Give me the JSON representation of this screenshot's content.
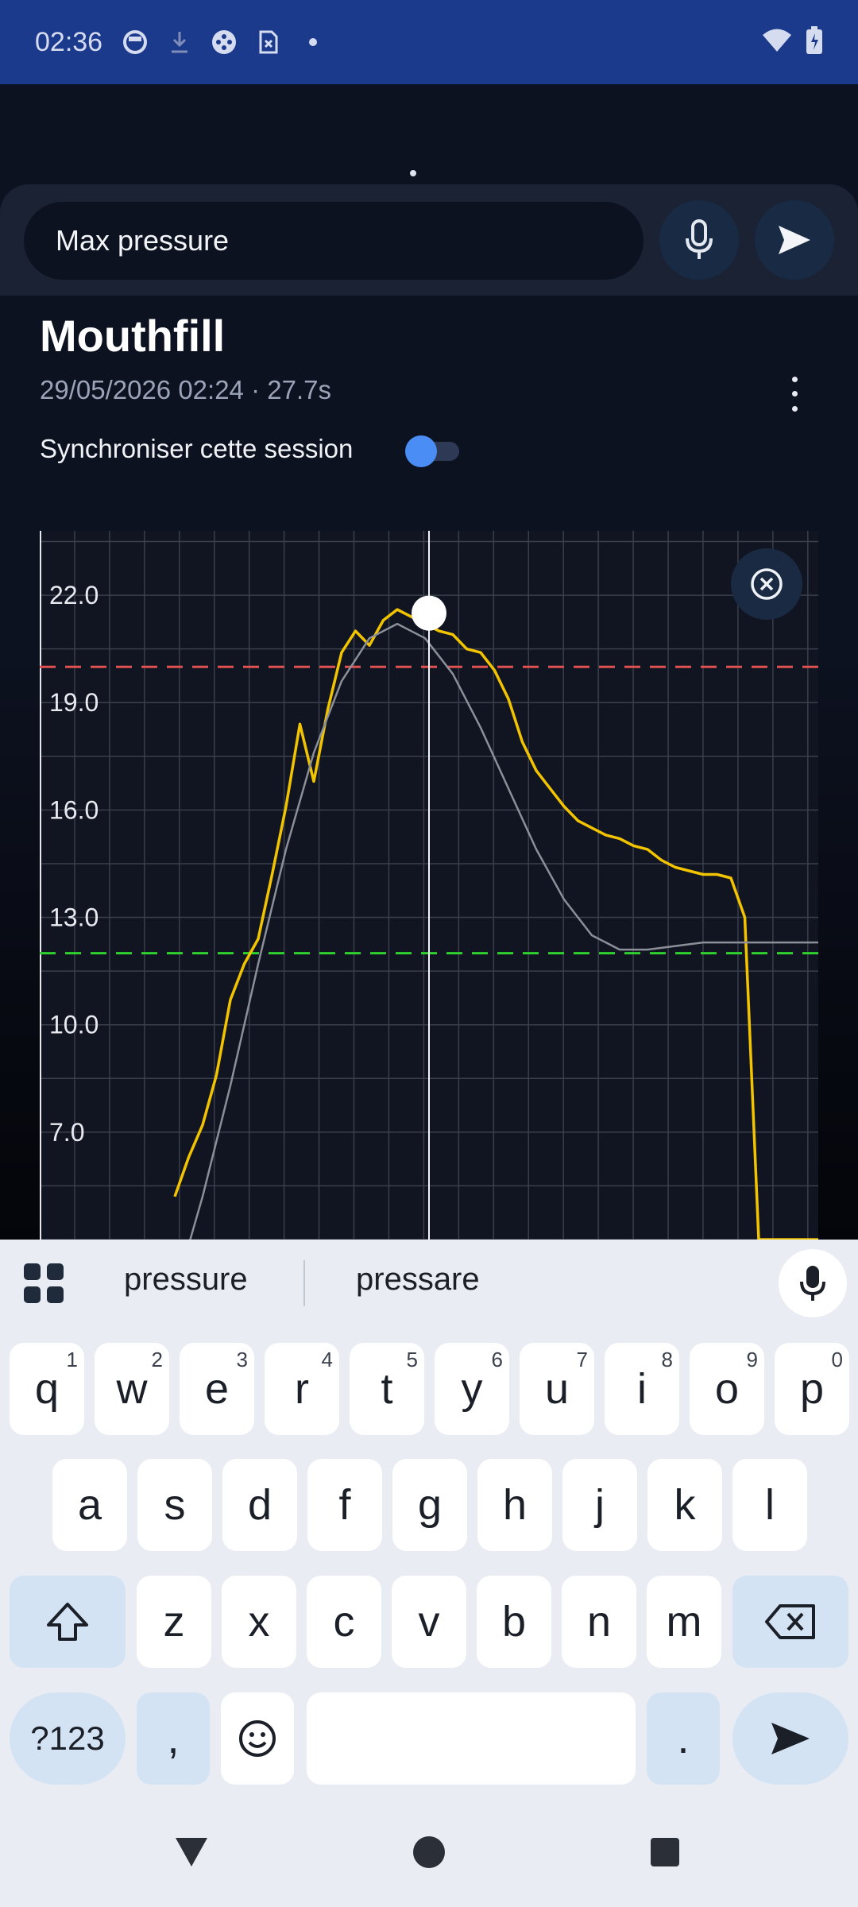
{
  "status_bar": {
    "time": "02:36"
  },
  "search": {
    "value": "Max pressure"
  },
  "session": {
    "title": "Mouthfill",
    "subtitle": "29/05/2026 02:24 · 27.7s",
    "sync_label": "Synchroniser cette session",
    "sync_enabled": true
  },
  "chart_data": {
    "type": "line",
    "ylabel": "",
    "xlabel": "",
    "yticks": [
      "22.0",
      "19.0",
      "16.0",
      "13.0",
      "10.0",
      "7.0"
    ],
    "ylim": [
      4.0,
      23.8
    ],
    "threshold_upper": 20.0,
    "threshold_lower": 12.0,
    "cursor_value": 21.5,
    "grid": true,
    "series": [
      {
        "color": "#f2c400",
        "x": [
          0,
          0.5,
          1,
          1.5,
          2,
          2.5,
          3,
          3.5,
          4,
          4.5,
          5,
          5.5,
          6,
          6.5,
          7,
          7.5,
          8,
          8.5,
          9,
          9.5,
          10,
          10.5,
          11,
          11.5,
          12,
          12.5,
          13,
          13.5,
          14,
          14.5,
          15,
          15.5,
          16,
          16.5,
          17,
          17.5,
          18,
          18.5,
          19,
          19.5,
          20,
          20.5,
          21,
          21.5,
          22,
          22.5,
          23,
          23.5,
          24,
          24.5,
          25,
          25.5,
          26,
          26.5,
          27,
          27.2,
          27.5
        ],
        "y": [
          5.2,
          6.3,
          7.2,
          8.6,
          10.7,
          11.7,
          12.4,
          14.2,
          16.1,
          18.4,
          16.8,
          18.8,
          20.4,
          21.0,
          20.6,
          21.3,
          21.6,
          21.4,
          21.2,
          21.0,
          20.9,
          20.5,
          20.4,
          19.9,
          19.1,
          17.9,
          17.1,
          16.6,
          16.1,
          15.7,
          15.5,
          15.3,
          15.2,
          15.0,
          14.9,
          14.6,
          14.4,
          14.3,
          14.2,
          14.2,
          14.1,
          13.0,
          4.0,
          4.0,
          4.0,
          4.0,
          4.0,
          4.0,
          4.0,
          4.0,
          4.0,
          4.0,
          4.0,
          4.0,
          4.0,
          4.0,
          4.0
        ]
      },
      {
        "color": "#8a8f98",
        "x": [
          0,
          1,
          2,
          3,
          4,
          5,
          6,
          7,
          8,
          9,
          10,
          11,
          12,
          13,
          14,
          15,
          16,
          17,
          18,
          19,
          20,
          21,
          22,
          23,
          24,
          25,
          26,
          27,
          27.5
        ],
        "y": [
          2.5,
          5.2,
          8.3,
          11.7,
          14.9,
          17.6,
          19.6,
          20.8,
          21.2,
          20.8,
          19.8,
          18.3,
          16.6,
          14.9,
          13.5,
          12.5,
          12.1,
          12.1,
          12.2,
          12.3,
          12.3,
          12.3,
          12.3,
          12.3,
          12.3,
          12.3,
          12.3,
          12.3,
          12.3
        ]
      }
    ]
  },
  "keyboard": {
    "suggestions": [
      "pressure",
      "pressare"
    ],
    "row1": [
      [
        "q",
        "1"
      ],
      [
        "w",
        "2"
      ],
      [
        "e",
        "3"
      ],
      [
        "r",
        "4"
      ],
      [
        "t",
        "5"
      ],
      [
        "y",
        "6"
      ],
      [
        "u",
        "7"
      ],
      [
        "i",
        "8"
      ],
      [
        "o",
        "9"
      ],
      [
        "p",
        "0"
      ]
    ],
    "row2": [
      "a",
      "s",
      "d",
      "f",
      "g",
      "h",
      "j",
      "k",
      "l"
    ],
    "row3": [
      "z",
      "x",
      "c",
      "v",
      "b",
      "n",
      "m"
    ],
    "symbols_label": "?123",
    "comma": ",",
    "period": "."
  }
}
